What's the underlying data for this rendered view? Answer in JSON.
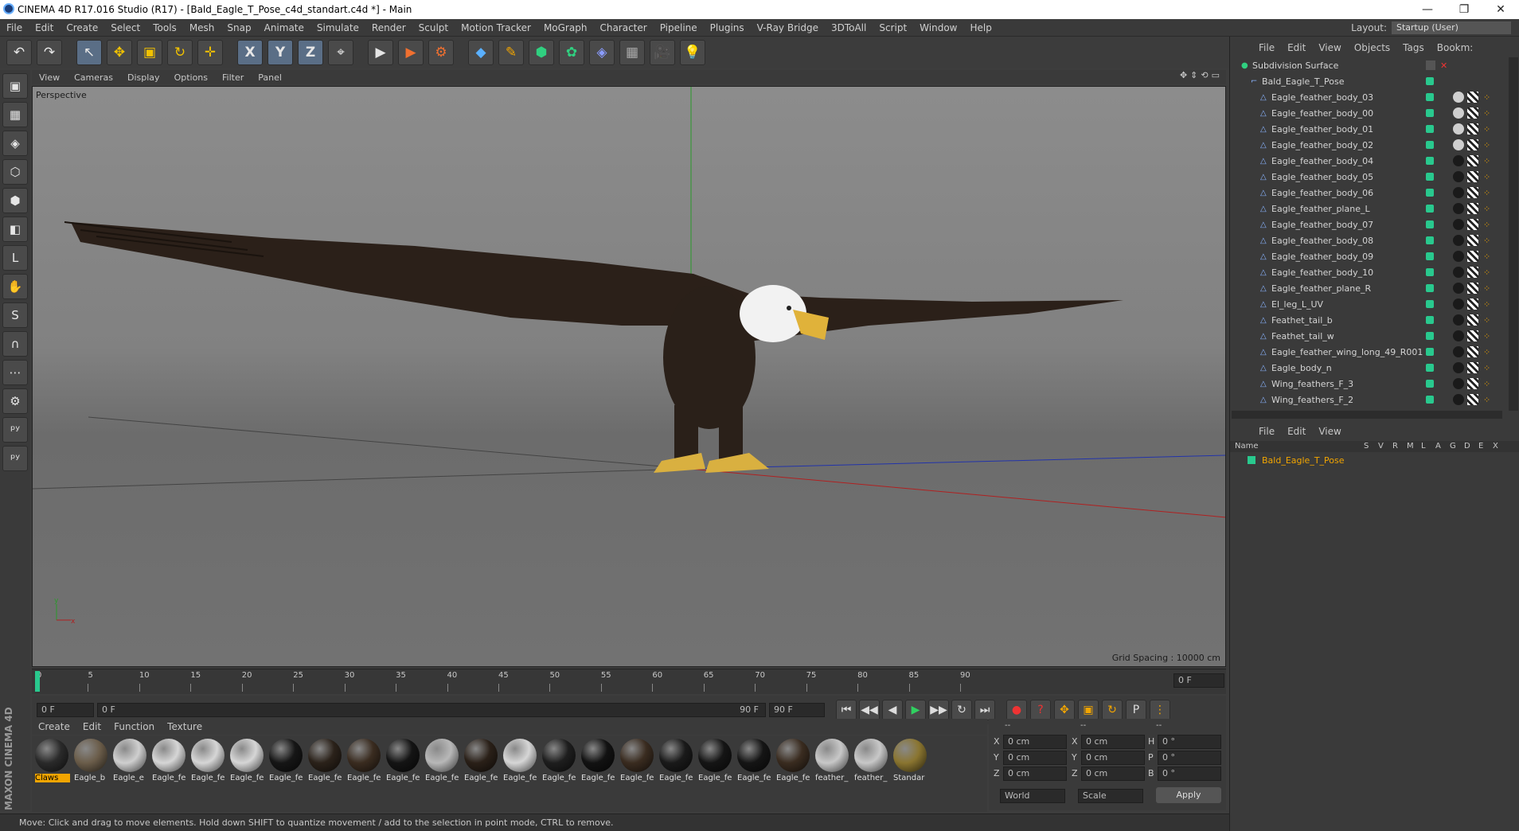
{
  "title": "CINEMA 4D R17.016 Studio (R17) - [Bald_Eagle_T_Pose_c4d_standart.c4d *] - Main",
  "menu": [
    "File",
    "Edit",
    "Create",
    "Select",
    "Tools",
    "Mesh",
    "Snap",
    "Animate",
    "Simulate",
    "Render",
    "Sculpt",
    "Motion Tracker",
    "MoGraph",
    "Character",
    "Pipeline",
    "Plugins",
    "V-Ray Bridge",
    "3DToAll",
    "Script",
    "Window",
    "Help"
  ],
  "layout": {
    "label": "Layout:",
    "value": "Startup (User)"
  },
  "toolbar": {
    "undo": "↶",
    "redo": "↷",
    "select": "↖",
    "move": "✥",
    "scale": "▣",
    "rotate": "↻",
    "multi": "✛",
    "x": "X",
    "y": "Y",
    "z": "Z",
    "coord": "⌖",
    "render": "▶",
    "render2": "▶",
    "render3": "⚙",
    "cube": "◆",
    "pen": "✎",
    "nurbs": "⬢",
    "cloner": "✿",
    "deformer": "◈",
    "floor": "▦",
    "camera": "🎥",
    "light": "💡"
  },
  "left_tools": [
    "▣",
    "▦",
    "◈",
    "⬡",
    "⬢",
    "◧",
    "L",
    "✋",
    "S",
    "∩",
    "⋯",
    "⚙",
    "ᵖʸ",
    "ᵖʸ"
  ],
  "viewport": {
    "menu": [
      "View",
      "Cameras",
      "Display",
      "Options",
      "Filter",
      "Panel"
    ],
    "label": "Perspective",
    "grid_spacing": "Grid Spacing : 10000 cm",
    "nav_icons": [
      "✥",
      "⇕",
      "⟲",
      "▭"
    ]
  },
  "timeline": {
    "ticks": [
      "0",
      "5",
      "10",
      "15",
      "20",
      "25",
      "30",
      "35",
      "40",
      "45",
      "50",
      "55",
      "60",
      "65",
      "70",
      "75",
      "80",
      "85",
      "90"
    ],
    "end_field": "0 F",
    "start_field": "0 F",
    "range_start": "0 F",
    "range_end": "90 F",
    "max_field": "90 F"
  },
  "playback": [
    "⏮",
    "◀◀",
    "◀",
    "▶",
    "▶▶",
    "↻",
    "⏭"
  ],
  "materials": {
    "menu": [
      "Create",
      "Edit",
      "Function",
      "Texture"
    ],
    "items": [
      {
        "label": "Claws",
        "color": "#2a2a2a",
        "active": true
      },
      {
        "label": "Eagle_b",
        "color": "#6b5d4a"
      },
      {
        "label": "Eagle_e",
        "color": "#cfcfcf"
      },
      {
        "label": "Eagle_fe",
        "color": "#d6d6d6"
      },
      {
        "label": "Eagle_fe",
        "color": "#d6d6d6"
      },
      {
        "label": "Eagle_fe",
        "color": "#d6d6d6"
      },
      {
        "label": "Eagle_fe",
        "color": "#161616"
      },
      {
        "label": "Eagle_fe",
        "color": "#2b221a"
      },
      {
        "label": "Eagle_fe",
        "color": "#3a2c20"
      },
      {
        "label": "Eagle_fe",
        "color": "#141414"
      },
      {
        "label": "Eagle_fe",
        "color": "#b8b8b8"
      },
      {
        "label": "Eagle_fe",
        "color": "#2a2018"
      },
      {
        "label": "Eagle_fe",
        "color": "#d6d6d6"
      },
      {
        "label": "Eagle_fe",
        "color": "#1e1e1e"
      },
      {
        "label": "Eagle_fe",
        "color": "#121212"
      },
      {
        "label": "Eagle_fe",
        "color": "#3a2c20"
      },
      {
        "label": "Eagle_fe",
        "color": "#1a1a1a"
      },
      {
        "label": "Eagle_fe",
        "color": "#151515"
      },
      {
        "label": "Eagle_fe",
        "color": "#151515"
      },
      {
        "label": "Eagle_fe",
        "color": "#3a2c20"
      },
      {
        "label": "feather_",
        "color": "#c8c8c8"
      },
      {
        "label": "feather_",
        "color": "#c8c8c8"
      },
      {
        "label": "Standar",
        "color": "#8a7530"
      }
    ]
  },
  "coords": {
    "headers": [
      "--",
      "--",
      "--"
    ],
    "rows": [
      {
        "a": "X",
        "av": "0 cm",
        "b": "X",
        "bv": "0 cm",
        "c": "H",
        "cv": "0 °"
      },
      {
        "a": "Y",
        "av": "0 cm",
        "b": "Y",
        "bv": "0 cm",
        "c": "P",
        "cv": "0 °"
      },
      {
        "a": "Z",
        "av": "0 cm",
        "b": "Z",
        "bv": "0 cm",
        "c": "B",
        "cv": "0 °"
      }
    ],
    "world": "World",
    "scale": "Scale",
    "apply": "Apply"
  },
  "status": "Move: Click and drag to move elements. Hold down SHIFT to quantize movement / add to the selection in point mode, CTRL to remove.",
  "objects": {
    "menu": [
      "File",
      "Edit",
      "View",
      "Objects",
      "Tags",
      "Bookm:"
    ],
    "items": [
      {
        "name": "Subdivision Surface",
        "indent": 0
      },
      {
        "name": "Bald_Eagle_T_Pose",
        "indent": 1
      },
      {
        "name": "Eagle_feather_body_03",
        "indent": 2
      },
      {
        "name": "Eagle_feather_body_00",
        "indent": 2
      },
      {
        "name": "Eagle_feather_body_01",
        "indent": 2
      },
      {
        "name": "Eagle_feather_body_02",
        "indent": 2
      },
      {
        "name": "Eagle_feather_body_04",
        "indent": 2
      },
      {
        "name": "Eagle_feather_body_05",
        "indent": 2
      },
      {
        "name": "Eagle_feather_body_06",
        "indent": 2
      },
      {
        "name": "Eagle_feather_plane_L",
        "indent": 2
      },
      {
        "name": "Eagle_feather_body_07",
        "indent": 2
      },
      {
        "name": "Eagle_feather_body_08",
        "indent": 2
      },
      {
        "name": "Eagle_feather_body_09",
        "indent": 2
      },
      {
        "name": "Eagle_feather_body_10",
        "indent": 2
      },
      {
        "name": "Eagle_feather_plane_R",
        "indent": 2
      },
      {
        "name": "El_leg_L_UV",
        "indent": 2
      },
      {
        "name": "Feathet_tail_b",
        "indent": 2
      },
      {
        "name": "Feathet_tail_w",
        "indent": 2
      },
      {
        "name": "Eagle_feather_wing_long_49_R001",
        "indent": 2
      },
      {
        "name": "Eagle_body_n",
        "indent": 2
      },
      {
        "name": "Wing_feathers_F_3",
        "indent": 2
      },
      {
        "name": "Wing_feathers_F_2",
        "indent": 2
      }
    ]
  },
  "attributes": {
    "menu": [
      "File",
      "Edit",
      "View"
    ],
    "columns": [
      "Name",
      "S",
      "V",
      "R",
      "M",
      "L",
      "A",
      "G",
      "D",
      "E",
      "X"
    ],
    "layer": "Bald_Eagle_T_Pose"
  },
  "brand": "MAXON CINEMA 4D",
  "colors": {
    "accent": "#f2a500",
    "green": "#29c98e",
    "selection": "#5a6e86"
  }
}
